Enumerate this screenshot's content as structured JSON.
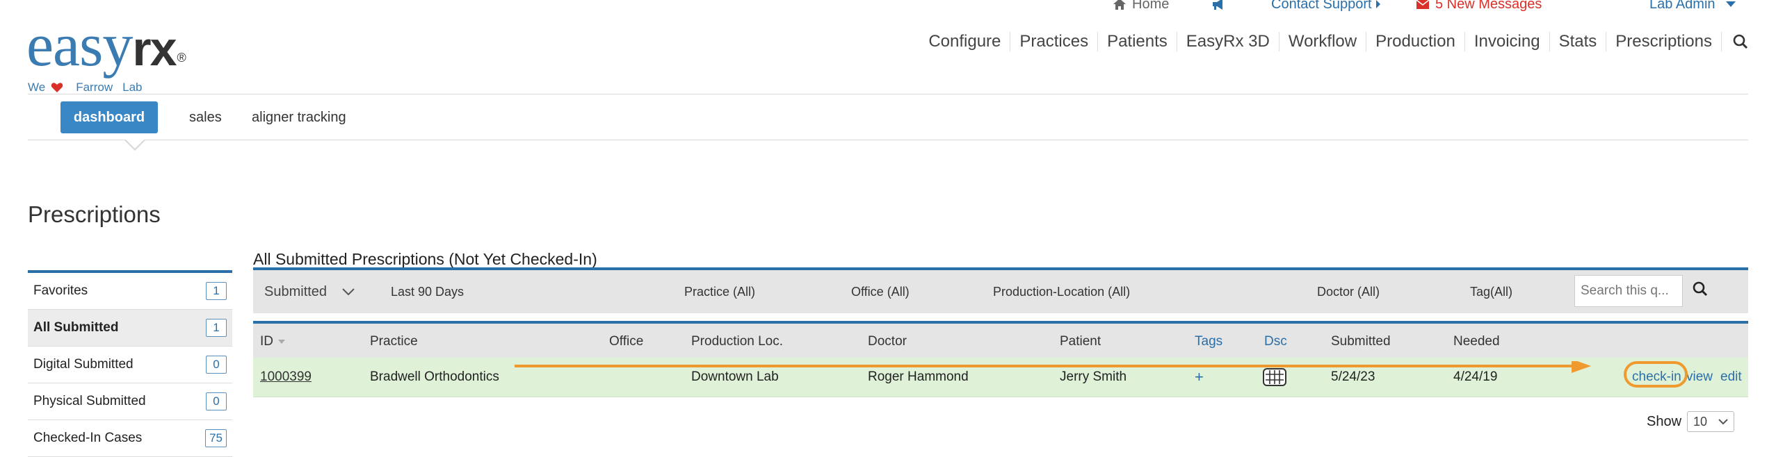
{
  "utility": {
    "home": "Home",
    "contact": "Contact Support",
    "messages": "5 New Messages",
    "user": "Lab Admin"
  },
  "logo": {
    "easy": "easy",
    "rx": "rx",
    "reg": "®",
    "tag_we": "We",
    "tag_lab1": "Farrow",
    "tag_lab2": "Lab"
  },
  "nav": {
    "items": [
      "Configure",
      "Practices",
      "Patients",
      "EasyRx 3D",
      "Workflow",
      "Production",
      "Invoicing",
      "Stats",
      "Prescriptions"
    ]
  },
  "subtabs": [
    "dashboard",
    "sales",
    "aligner tracking"
  ],
  "page_title": "Prescriptions",
  "sidebar": {
    "items": [
      {
        "label": "Favorites",
        "count": "1"
      },
      {
        "label": "All Submitted",
        "count": "1"
      },
      {
        "label": "Digital Submitted",
        "count": "0"
      },
      {
        "label": "Physical Submitted",
        "count": "0"
      },
      {
        "label": "Checked-In Cases",
        "count": "75"
      }
    ]
  },
  "table": {
    "title": "All Submitted Prescriptions (Not Yet Checked-In)",
    "filters": {
      "status": "Submitted",
      "range": "Last 90 Days",
      "practice": "Practice (All)",
      "office": "Office (All)",
      "production_location": "Production-Location (All)",
      "doctor": "Doctor (All)",
      "tag": "Tag(All)",
      "search_placeholder": "Search this q..."
    },
    "headers": {
      "id": "ID",
      "practice": "Practice",
      "office": "Office",
      "production_loc": "Production Loc.",
      "doctor": "Doctor",
      "patient": "Patient",
      "tags": "Tags",
      "dsc": "Dsc",
      "submitted": "Submitted",
      "needed": "Needed"
    },
    "rows": [
      {
        "id": "1000399",
        "practice": "Bradwell Orthodontics",
        "office": "",
        "production_loc": "Downtown Lab",
        "doctor": "Roger Hammond",
        "patient": "Jerry Smith",
        "tags": "+",
        "submitted": "5/24/23",
        "needed": "4/24/19",
        "actions": {
          "checkin": "check-in",
          "view": "view",
          "edit": "edit"
        }
      }
    ],
    "show_label": "Show",
    "show_value": "10"
  },
  "colors": {
    "brand_blue": "#2a6fa8",
    "active_tab": "#3a87c6",
    "row_green": "#dff2d8",
    "annotation_orange": "#ef9a2e",
    "message_red": "#d9302a"
  }
}
